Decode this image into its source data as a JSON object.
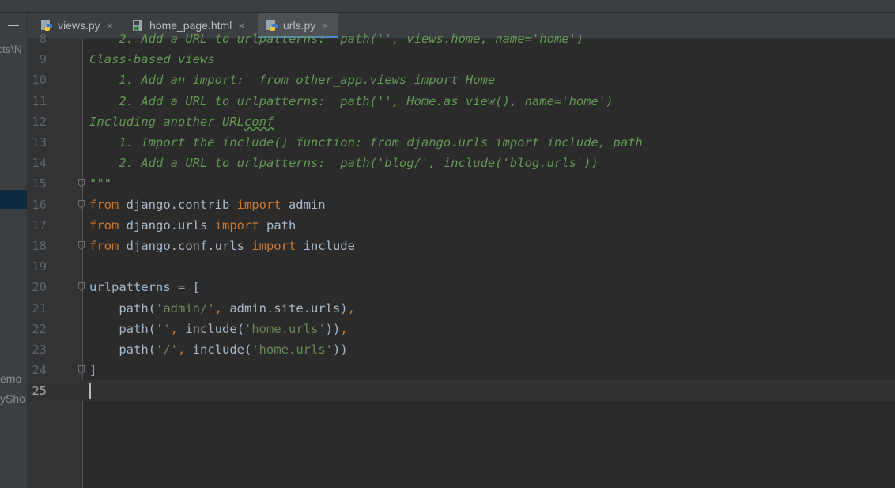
{
  "tabs": [
    {
      "label": "views.py",
      "icon": "python-file-icon",
      "active": false
    },
    {
      "label": "home_page.html",
      "icon": "html-file-icon",
      "active": false
    },
    {
      "label": "urls.py",
      "icon": "python-file-icon",
      "active": true
    }
  ],
  "close_glyph": "×",
  "sidebar": {
    "path_fragment": "cts\\N",
    "items": [
      "emo",
      "ySho"
    ]
  },
  "editor": {
    "current_line": "25",
    "lines": [
      {
        "num": "8",
        "segments": [
          {
            "t": "    2. Add a URL to urlpatterns:  path('', views.home, name='home')",
            "c": "doc"
          }
        ]
      },
      {
        "num": "9",
        "segments": [
          {
            "t": "Class-based views",
            "c": "doc"
          }
        ]
      },
      {
        "num": "10",
        "segments": [
          {
            "t": "    1. Add an import:  from other_app.views import Home",
            "c": "doc"
          }
        ]
      },
      {
        "num": "11",
        "segments": [
          {
            "t": "    2. Add a URL to urlpatterns:  path('', Home.as_view(), name='home')",
            "c": "doc"
          }
        ]
      },
      {
        "num": "12",
        "segments": [
          {
            "t": "Including another URL",
            "c": "doc"
          },
          {
            "t": "conf",
            "c": "doc wavy"
          }
        ]
      },
      {
        "num": "13",
        "segments": [
          {
            "t": "    1. Import the include() function: from django.urls import include, path",
            "c": "doc"
          }
        ]
      },
      {
        "num": "14",
        "segments": [
          {
            "t": "    2. Add a URL to urlpatterns:  path('blog/', include('blog.urls'))",
            "c": "doc"
          }
        ]
      },
      {
        "num": "15",
        "segments": [
          {
            "t": "\"\"\"",
            "c": "doc"
          }
        ]
      },
      {
        "num": "16",
        "segments": [
          {
            "t": "from",
            "c": "kw"
          },
          {
            "t": " django.contrib ",
            "c": "plain"
          },
          {
            "t": "import",
            "c": "kw"
          },
          {
            "t": " admin",
            "c": "plain"
          }
        ]
      },
      {
        "num": "17",
        "segments": [
          {
            "t": "from",
            "c": "kw"
          },
          {
            "t": " django.urls ",
            "c": "plain"
          },
          {
            "t": "import",
            "c": "kw"
          },
          {
            "t": " path",
            "c": "plain"
          }
        ]
      },
      {
        "num": "18",
        "segments": [
          {
            "t": "from",
            "c": "kw"
          },
          {
            "t": " django.conf.urls ",
            "c": "plain"
          },
          {
            "t": "import",
            "c": "kw"
          },
          {
            "t": " include",
            "c": "plain"
          }
        ]
      },
      {
        "num": "19",
        "segments": []
      },
      {
        "num": "20",
        "segments": [
          {
            "t": "urlpatterns = [",
            "c": "plain"
          }
        ]
      },
      {
        "num": "21",
        "segments": [
          {
            "t": "    path(",
            "c": "plain"
          },
          {
            "t": "'admin/'",
            "c": "str"
          },
          {
            "t": ",",
            "c": "kw"
          },
          {
            "t": " admin.site.urls)",
            "c": "plain"
          },
          {
            "t": ",",
            "c": "kw"
          }
        ]
      },
      {
        "num": "22",
        "segments": [
          {
            "t": "    path(",
            "c": "plain"
          },
          {
            "t": "''",
            "c": "str"
          },
          {
            "t": ",",
            "c": "kw"
          },
          {
            "t": " include(",
            "c": "plain"
          },
          {
            "t": "'home.urls'",
            "c": "str"
          },
          {
            "t": "))",
            "c": "plain"
          },
          {
            "t": ",",
            "c": "kw"
          }
        ]
      },
      {
        "num": "23",
        "segments": [
          {
            "t": "    path(",
            "c": "plain"
          },
          {
            "t": "'/'",
            "c": "str"
          },
          {
            "t": ",",
            "c": "kw"
          },
          {
            "t": " include(",
            "c": "plain"
          },
          {
            "t": "'home.urls'",
            "c": "str"
          },
          {
            "t": "))",
            "c": "plain"
          }
        ]
      },
      {
        "num": "24",
        "segments": [
          {
            "t": "]",
            "c": "plain"
          }
        ]
      },
      {
        "num": "25",
        "segments": []
      }
    ]
  },
  "colors": {
    "background": "#2b2b2b",
    "keyword": "#cc7832",
    "string": "#6a8759",
    "docstring": "#629755",
    "identifier": "#a9b7c6",
    "tab_underline": "#4a88c7"
  }
}
